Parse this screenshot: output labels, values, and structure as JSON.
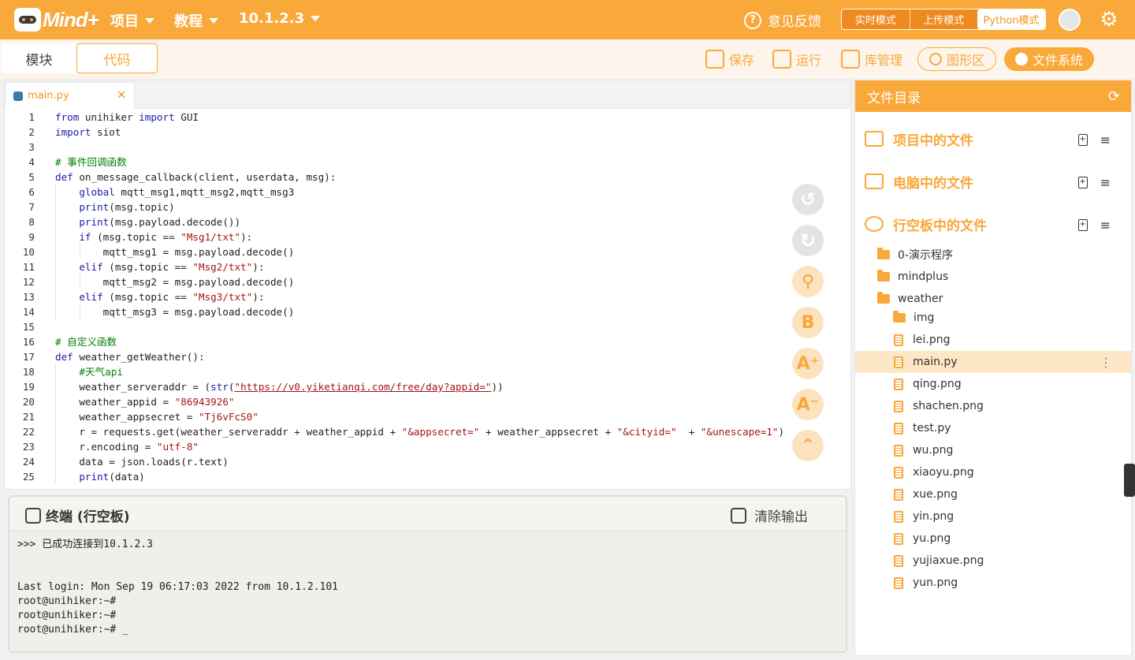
{
  "topbar": {
    "logo_text": "Mind+",
    "menus": [
      {
        "label": "项目"
      },
      {
        "label": "教程"
      },
      {
        "label": "10.1.2.3"
      }
    ],
    "feedback": "意见反馈",
    "modes": [
      "实时模式",
      "上传模式",
      "Python模式"
    ],
    "active_mode": "Python模式"
  },
  "subbar": {
    "tabs": [
      "模块",
      "代码"
    ],
    "tools": {
      "save": "保存",
      "run": "运行",
      "libs": "库管理",
      "graph": "图形区",
      "files": "文件系统"
    }
  },
  "editor": {
    "file_tab": "main.py",
    "lines": [
      "1",
      "2",
      "3",
      "4",
      "5",
      "6",
      "7",
      "8",
      "9",
      "10",
      "11",
      "12",
      "13",
      "14",
      "15",
      "16",
      "17",
      "18",
      "19",
      "20",
      "21",
      "22",
      "23",
      "24",
      "25"
    ]
  },
  "terminal": {
    "title": "终端 (行空板)",
    "clear": "清除输出",
    "lines": [
      ">>> 已成功连接到10.1.2.3",
      "",
      "",
      "Last login: Mon Sep 19 06:17:03 2022 from 10.1.2.101",
      "root@unihiker:~#",
      "root@unihiker:~#",
      "root@unihiker:~# _"
    ]
  },
  "files": {
    "header": "文件目录",
    "sections": [
      "项目中的文件",
      "电脑中的文件",
      "行空板中的文件"
    ],
    "items": [
      {
        "name": "0-演示程序",
        "type": "folder"
      },
      {
        "name": "mindplus",
        "type": "folder"
      },
      {
        "name": "weather",
        "type": "folder-open"
      },
      {
        "name": "img",
        "type": "folder"
      },
      {
        "name": "lei.png",
        "type": "file"
      },
      {
        "name": "main.py",
        "type": "file"
      },
      {
        "name": "qing.png",
        "type": "file"
      },
      {
        "name": "shachen.png",
        "type": "file"
      },
      {
        "name": "test.py",
        "type": "file"
      },
      {
        "name": "wu.png",
        "type": "file"
      },
      {
        "name": "xiaoyu.png",
        "type": "file"
      },
      {
        "name": "xue.png",
        "type": "file"
      },
      {
        "name": "yin.png",
        "type": "file"
      },
      {
        "name": "yu.png",
        "type": "file"
      },
      {
        "name": "yujiaxue.png",
        "type": "file"
      },
      {
        "name": "yun.png",
        "type": "file"
      }
    ],
    "selected": "main.py"
  },
  "colors": {
    "accent": "#f9a83a",
    "accent_light": "#fde2c0"
  }
}
